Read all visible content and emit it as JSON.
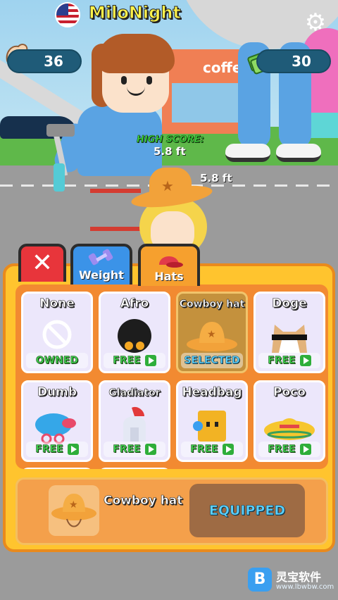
{
  "player": {
    "name": "MiloNight",
    "country_flag": "us-flag-icon"
  },
  "stats": {
    "strength": "36",
    "cash": "30"
  },
  "high_score": {
    "label": "HIGH SCORE:",
    "value": "5.8 ft"
  },
  "current_height": "5.8 ft",
  "scene": {
    "shop_sign": "coffee"
  },
  "tabs": {
    "close_icon": "close-icon",
    "weight_label": "Weight",
    "hats_label": "Hats",
    "active": "Hats"
  },
  "hats": [
    {
      "name": "None",
      "status": "OWNED",
      "icon": "none-icon"
    },
    {
      "name": "Afro",
      "status": "FREE",
      "icon": "afro-hat-icon"
    },
    {
      "name": "Cowboy hat",
      "status": "SELECTED",
      "icon": "cowboy-hat-icon"
    },
    {
      "name": "Doge",
      "status": "FREE",
      "icon": "doge-hat-icon"
    },
    {
      "name": "Dumb",
      "status": "FREE",
      "icon": "dumb-hat-icon"
    },
    {
      "name": "Gladiator",
      "status": "FREE",
      "icon": "gladiator-hat-icon"
    },
    {
      "name": "Headbag",
      "status": "FREE",
      "icon": "headbag-hat-icon"
    },
    {
      "name": "Poco",
      "status": "FREE",
      "icon": "poco-hat-icon"
    }
  ],
  "equipped": {
    "name": "Cowboy hat",
    "button_label": "EQUIPPED"
  },
  "watermark": {
    "text": "灵宝软件",
    "url": "www.lbwbw.com",
    "logo_letter": "B"
  },
  "colors": {
    "free_text": "#3fd04f",
    "selected_text": "#5ad1ff",
    "panel": "#ffc42e",
    "grid": "#f28a31"
  }
}
